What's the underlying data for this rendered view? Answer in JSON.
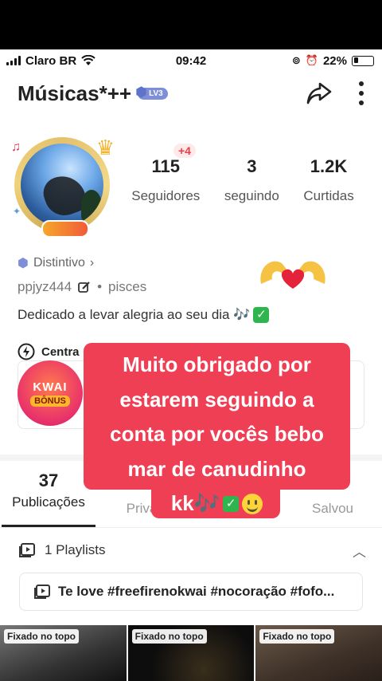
{
  "status_bar": {
    "carrier": "Claro BR",
    "time": "09:42",
    "battery": "22%"
  },
  "header": {
    "title": "Músicas*++",
    "level_badge": "LV3"
  },
  "profile": {
    "stats": [
      {
        "value": "115",
        "label": "Seguidores"
      },
      {
        "value": "3",
        "label": "seguindo"
      },
      {
        "value": "1.2K",
        "label": "Curtidas"
      }
    ],
    "new_followers_badge": "+4",
    "distintivo_label": "Distintivo",
    "handle": "ppjyz444",
    "sign": "pisces",
    "bio": "Dedicado a levar alegria ao seu dia 🎶"
  },
  "center": {
    "label": "Centra",
    "bonus_title": "KWAI",
    "bonus_sub": "BÔNUS"
  },
  "tabs": [
    {
      "count": "37",
      "label": "Publicações"
    },
    {
      "count": "",
      "label": "Priva"
    },
    {
      "count": "",
      "label": "Salvou"
    }
  ],
  "playlists": {
    "header": "1 Playlists",
    "item_title": "Te love #freefirenokwai #nocoração #fofo..."
  },
  "grid": {
    "pinned_label": "Fixado no topo"
  },
  "overlay_caption": {
    "line1": "Muito obrigado por",
    "line2": "estarem seguindo a",
    "line3": "conta por vocês bebo",
    "line4": "mar de canudinho",
    "line5": "kk🎶"
  },
  "colors": {
    "accent_red": "#ef3f55",
    "level_blue": "#7d8fd8",
    "gold_ring": "#e4c16d"
  }
}
